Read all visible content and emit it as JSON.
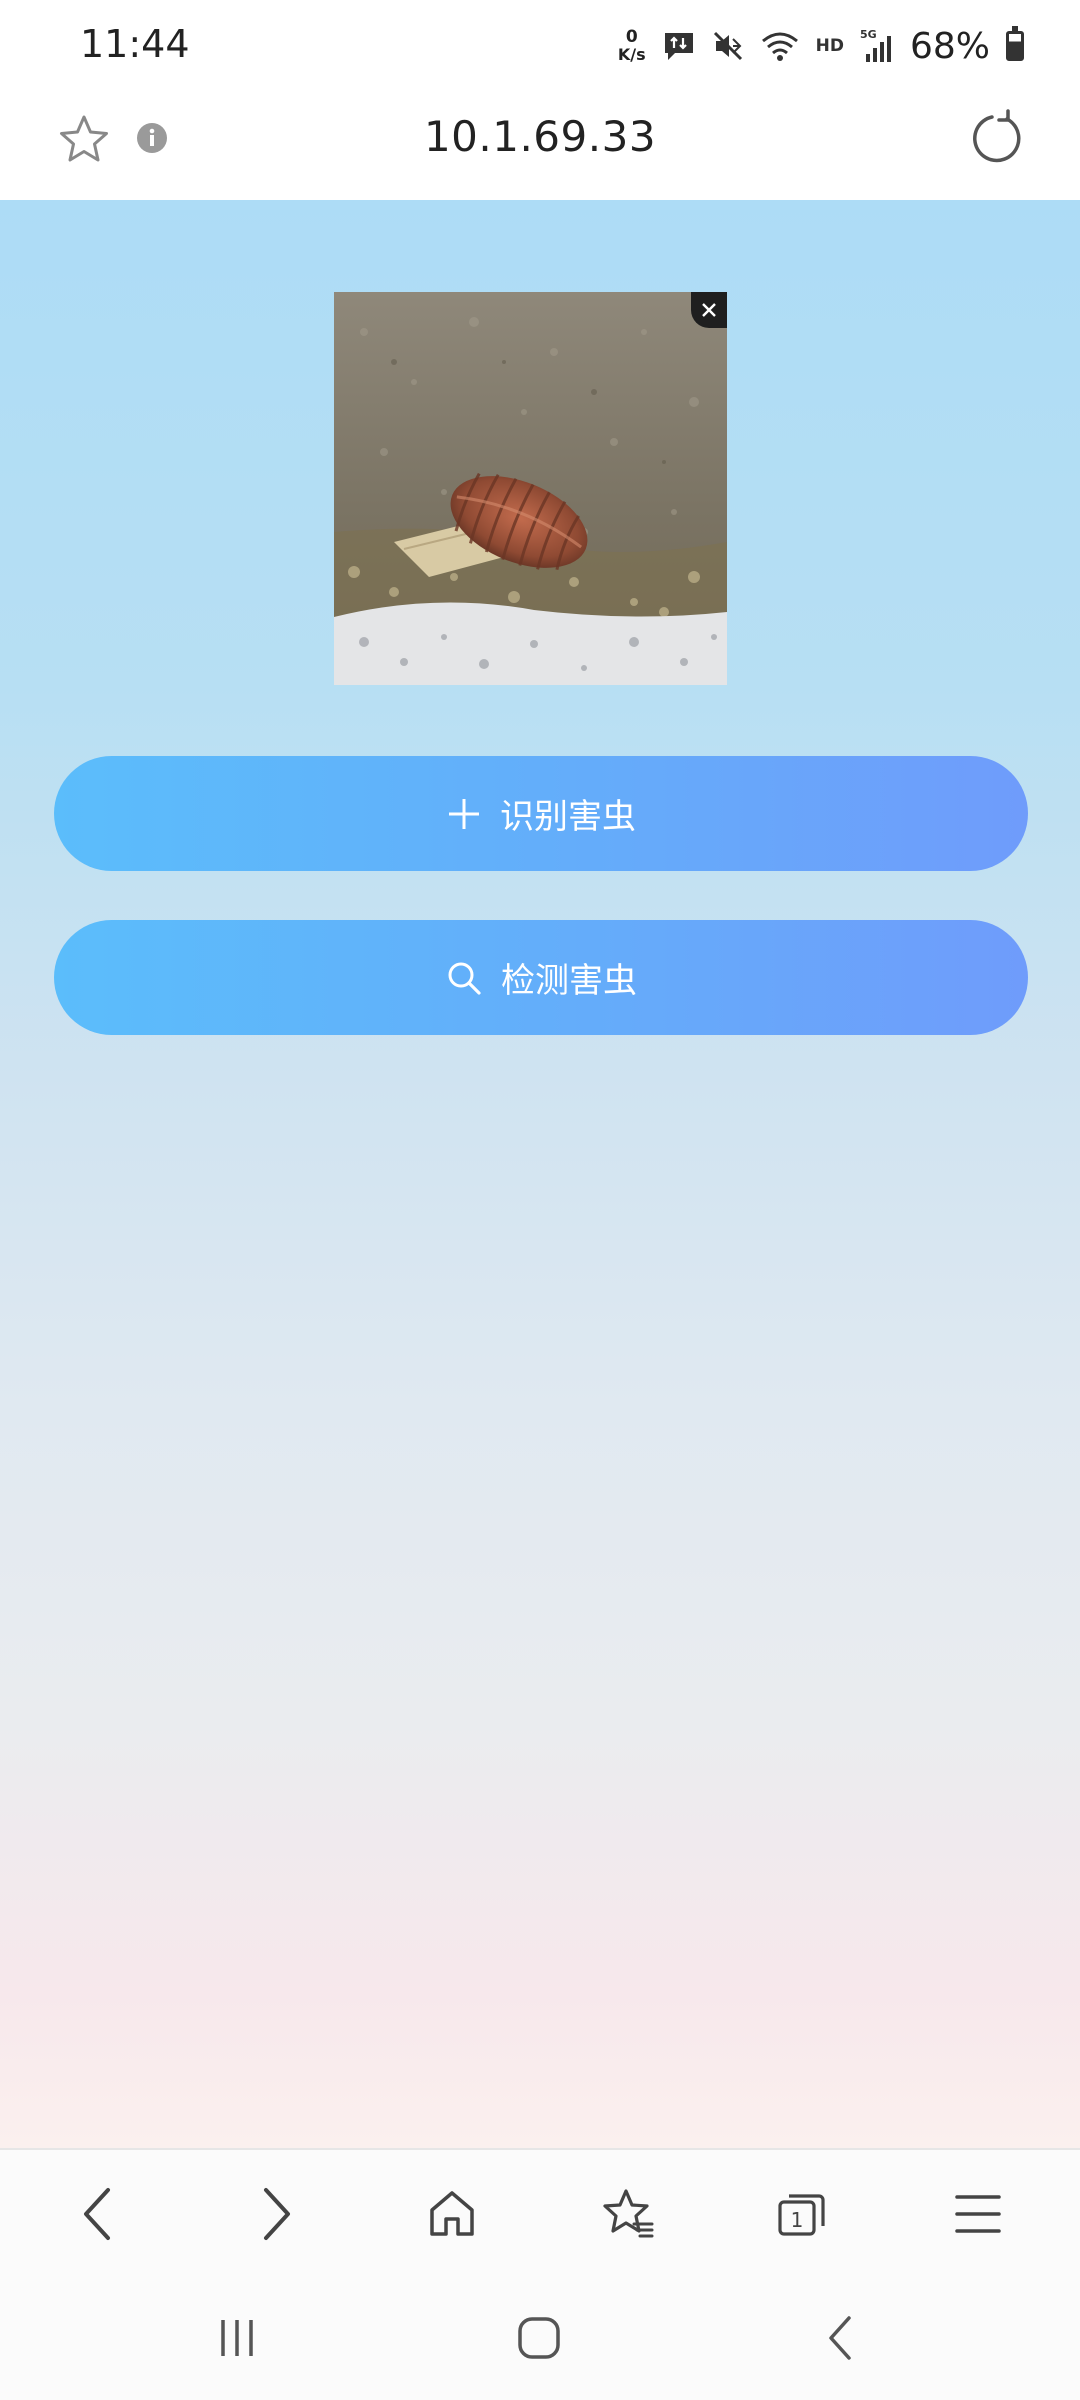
{
  "status_bar": {
    "time": "11:44",
    "net_speed_value": "0",
    "net_speed_unit": "K/s",
    "network_label": "HD",
    "signal_type": "5G",
    "battery_percent": "68%",
    "battery_level": 0.68,
    "icons": [
      "data-transfer-icon",
      "mute-icon",
      "wifi-icon",
      "signal-icon",
      "battery-icon"
    ]
  },
  "address_bar": {
    "url": "10.1.69.33",
    "icons": [
      "star-icon",
      "info-icon",
      "reload-icon"
    ]
  },
  "main": {
    "image": {
      "alt": "pest photo",
      "close_icon": "close-icon"
    },
    "identify_button": {
      "label": "识别害虫",
      "icon": "plus-icon"
    },
    "detect_button": {
      "label": "检测害虫",
      "icon": "search-icon"
    }
  },
  "browser_toolbar": {
    "items": [
      "back-icon",
      "forward-icon",
      "home-icon",
      "bookmarks-icon",
      "tabs-icon",
      "menu-icon"
    ],
    "tab_count": "1"
  },
  "system_nav": {
    "items": [
      "recents-icon",
      "home-icon",
      "back-icon"
    ]
  },
  "colors": {
    "button_gradient_start": "#5bbdfb",
    "button_gradient_end": "#6f9cfb",
    "background_top": "#addcf6",
    "background_bottom": "#fbf0ee"
  }
}
